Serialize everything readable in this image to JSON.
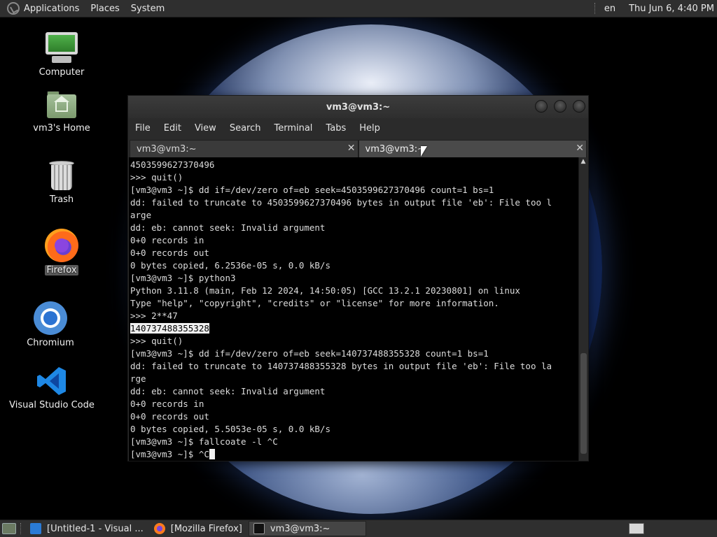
{
  "top_panel": {
    "menus": [
      "Applications",
      "Places",
      "System"
    ],
    "keyboard_layout": "en",
    "clock": "Thu Jun  6,  4:40 PM"
  },
  "desktop_icons": [
    {
      "label": "Computer",
      "icon": "computer-icon"
    },
    {
      "label": "vm3's Home",
      "icon": "home-folder-icon"
    },
    {
      "label": "Trash",
      "icon": "trash-icon"
    },
    {
      "label": "Firefox",
      "icon": "firefox-icon",
      "selected": true
    },
    {
      "label": "Chromium",
      "icon": "chromium-icon"
    },
    {
      "label": "Visual Studio Code",
      "icon": "vscode-icon"
    }
  ],
  "terminal": {
    "title": "vm3@vm3:~",
    "menu": [
      "File",
      "Edit",
      "View",
      "Search",
      "Terminal",
      "Tabs",
      "Help"
    ],
    "tabs": [
      {
        "label": "vm3@vm3:~",
        "active": false
      },
      {
        "label": "vm3@vm3:~",
        "active": true
      }
    ],
    "lines": [
      "4503599627370496",
      ">>> quit()",
      "[vm3@vm3 ~]$ dd if=/dev/zero of=eb seek=4503599627370496 count=1 bs=1",
      "dd: failed to truncate to 4503599627370496 bytes in output file 'eb': File too l",
      "arge",
      "dd: eb: cannot seek: Invalid argument",
      "0+0 records in",
      "0+0 records out",
      "0 bytes copied, 6.2536e-05 s, 0.0 kB/s",
      "[vm3@vm3 ~]$ python3",
      "Python 3.11.8 (main, Feb 12 2024, 14:50:05) [GCC 13.2.1 20230801] on linux",
      "Type \"help\", \"copyright\", \"credits\" or \"license\" for more information.",
      ">>> 2**47",
      "140737488355328",
      ">>> quit()",
      "[vm3@vm3 ~]$ dd if=/dev/zero of=eb seek=140737488355328 count=1 bs=1",
      "dd: failed to truncate to 140737488355328 bytes in output file 'eb': File too la",
      "rge",
      "dd: eb: cannot seek: Invalid argument",
      "0+0 records in",
      "0+0 records out",
      "0 bytes copied, 5.5053e-05 s, 0.0 kB/s",
      "[vm3@vm3 ~]$ fallcoate -l ^C",
      "[vm3@vm3 ~]$ ^C"
    ],
    "highlighted_line_index": 13
  },
  "taskbar": {
    "items": [
      {
        "label": "[Untitled-1 - Visual ...",
        "icon": "vscode-icon",
        "active": false
      },
      {
        "label": "[Mozilla Firefox]",
        "icon": "firefox-icon",
        "active": false
      },
      {
        "label": "vm3@vm3:~",
        "icon": "terminal-icon",
        "active": true
      }
    ]
  },
  "colors": {
    "panel_bg": "#2f2f2f",
    "terminal_bg": "#000000",
    "terminal_fg": "#dcdcdc",
    "selection_bg": "#f0f0f0"
  }
}
